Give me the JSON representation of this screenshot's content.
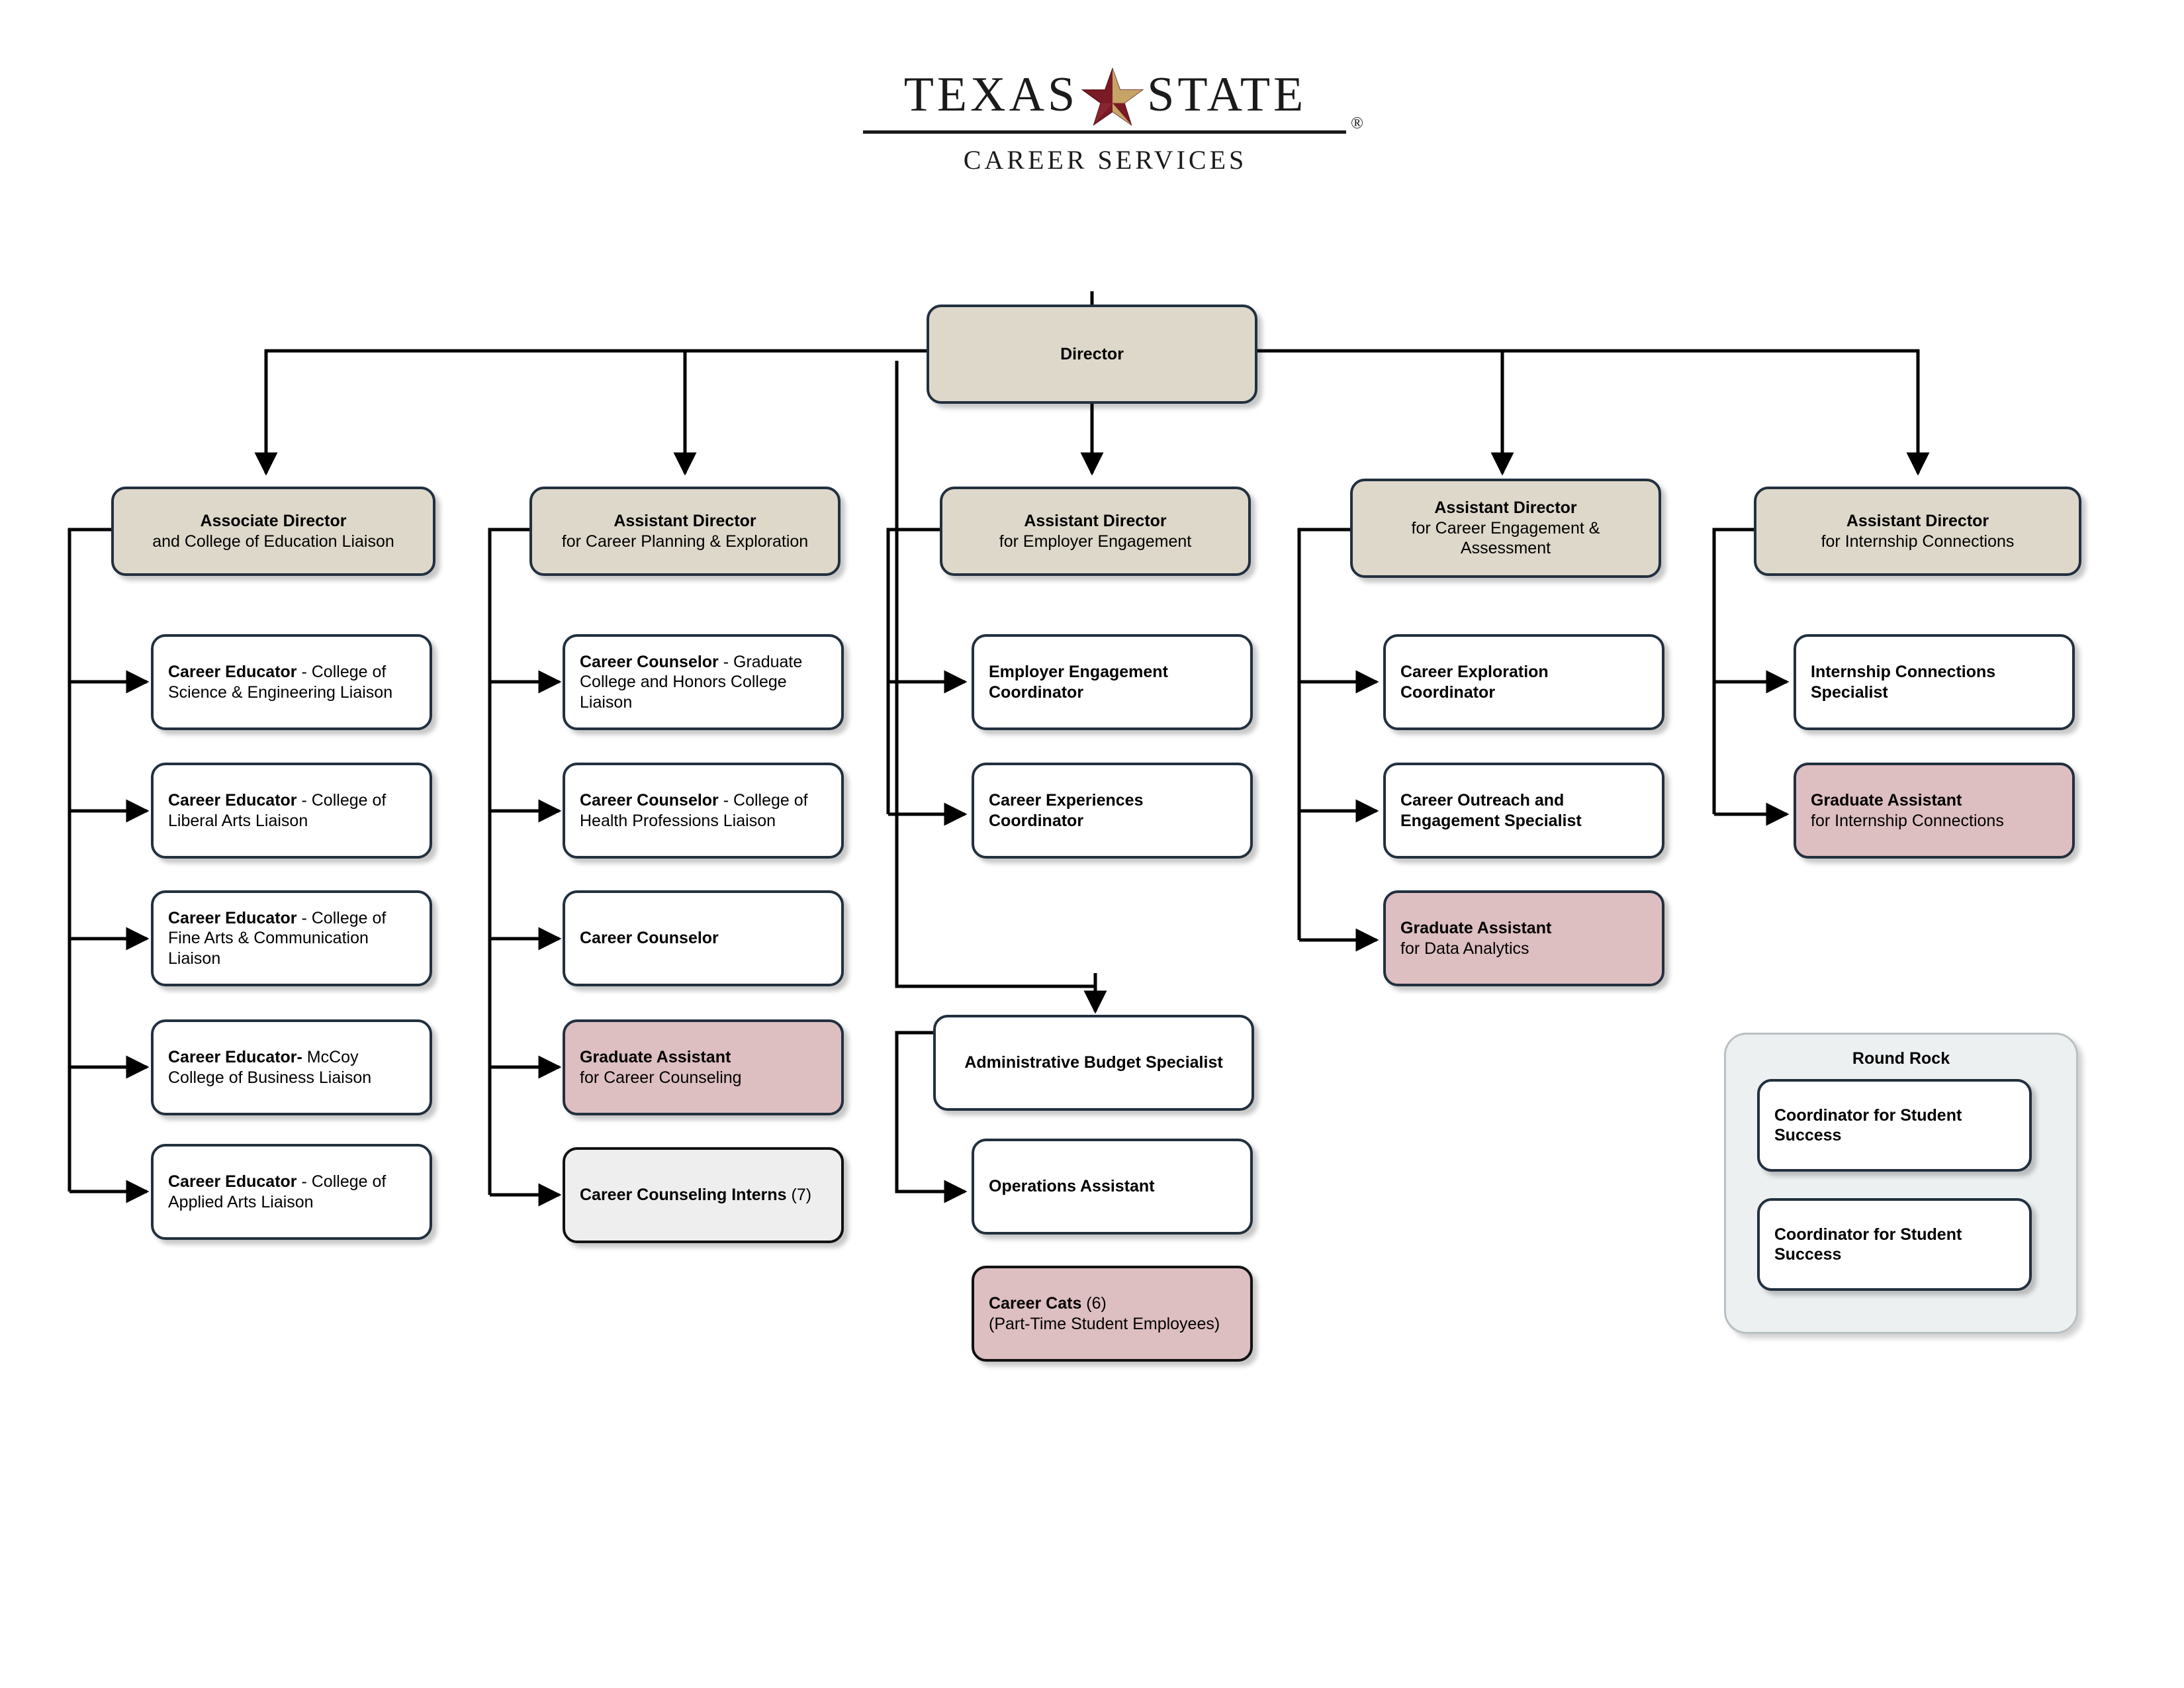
{
  "logo": {
    "word_left": "TEXAS",
    "word_right": "STATE",
    "star_icon": "texas-state-star",
    "registered_mark": "®",
    "subtitle": "CAREER SERVICES",
    "star_outer_color": "#7a1a25",
    "star_inner_color": "#c6a465"
  },
  "colors": {
    "tan_box": "#ddd8ca",
    "pink_box": "#ddbec1",
    "gray_box": "#eeeeee",
    "white_box": "#ffffff",
    "border": "#22303f",
    "group_fill": "#edf0f1",
    "group_border": "#b9c0c4"
  },
  "root": {
    "title": "Director"
  },
  "columns": [
    {
      "head": {
        "bold": "Associate Director",
        "rest": "and College of Education Liaison"
      },
      "children": [
        {
          "bold": "Career Educator",
          "rest": " - College of Science & Engineering Liaison"
        },
        {
          "bold": "Career Educator",
          "rest": " - College of Liberal Arts Liaison"
        },
        {
          "bold": "Career Educator",
          "rest": " - College of Fine Arts & Communication Liaison"
        },
        {
          "bold": "Career Educator-",
          "rest": " McCoy College of Business Liaison"
        },
        {
          "bold": "Career Educator",
          "rest": " - College of Applied Arts Liaison"
        }
      ]
    },
    {
      "head": {
        "bold": "Assistant Director",
        "rest": "for Career Planning & Exploration"
      },
      "children": [
        {
          "bold": "Career Counselor",
          "rest": " - Graduate College and Honors College Liaison"
        },
        {
          "bold": "Career Counselor",
          "rest": " - College of Health Professions Liaison"
        },
        {
          "bold": "Career Counselor",
          "rest": ""
        },
        {
          "bold": "Graduate Assistant",
          "rest": "for Career Counseling",
          "style": "pink"
        },
        {
          "bold": "Career Counseling Interns",
          "rest": " (7)",
          "style": "gray"
        }
      ]
    },
    {
      "head": {
        "bold": "Assistant Director",
        "rest": "for Employer Engagement"
      },
      "children": [
        {
          "bold": "Employer Engagement Coordinator",
          "rest": ""
        },
        {
          "bold": "Career Experiences Coordinator",
          "rest": ""
        }
      ],
      "direct_reports": [
        {
          "bold": "Administrative Budget Specialist",
          "rest": ""
        },
        {
          "bold": "Operations Assistant",
          "rest": ""
        },
        {
          "bold": "Career Cats",
          "rest": " (6)",
          "line2": "(Part-Time Student Employees)",
          "style": "pink"
        }
      ]
    },
    {
      "head": {
        "bold": "Assistant Director",
        "rest": "for Career Engagement & Assessment"
      },
      "children": [
        {
          "bold": "Career Exploration Coordinator",
          "rest": ""
        },
        {
          "bold": "Career Outreach and Engagement Specialist",
          "rest": ""
        },
        {
          "bold": "Graduate Assistant",
          "rest": "for Data Analytics",
          "style": "pink"
        }
      ]
    },
    {
      "head": {
        "bold": "Assistant Director",
        "rest": "for Internship Connections"
      },
      "children": [
        {
          "bold": "Internship Connections Specialist",
          "rest": ""
        },
        {
          "bold": "Graduate Assistant",
          "rest": "for Internship Connections",
          "style": "pink"
        }
      ]
    }
  ],
  "group": {
    "title": "Round Rock",
    "members": [
      {
        "bold": "Coordinator for Student Success",
        "rest": ""
      },
      {
        "bold": "Coordinator for Student Success",
        "rest": ""
      }
    ]
  }
}
